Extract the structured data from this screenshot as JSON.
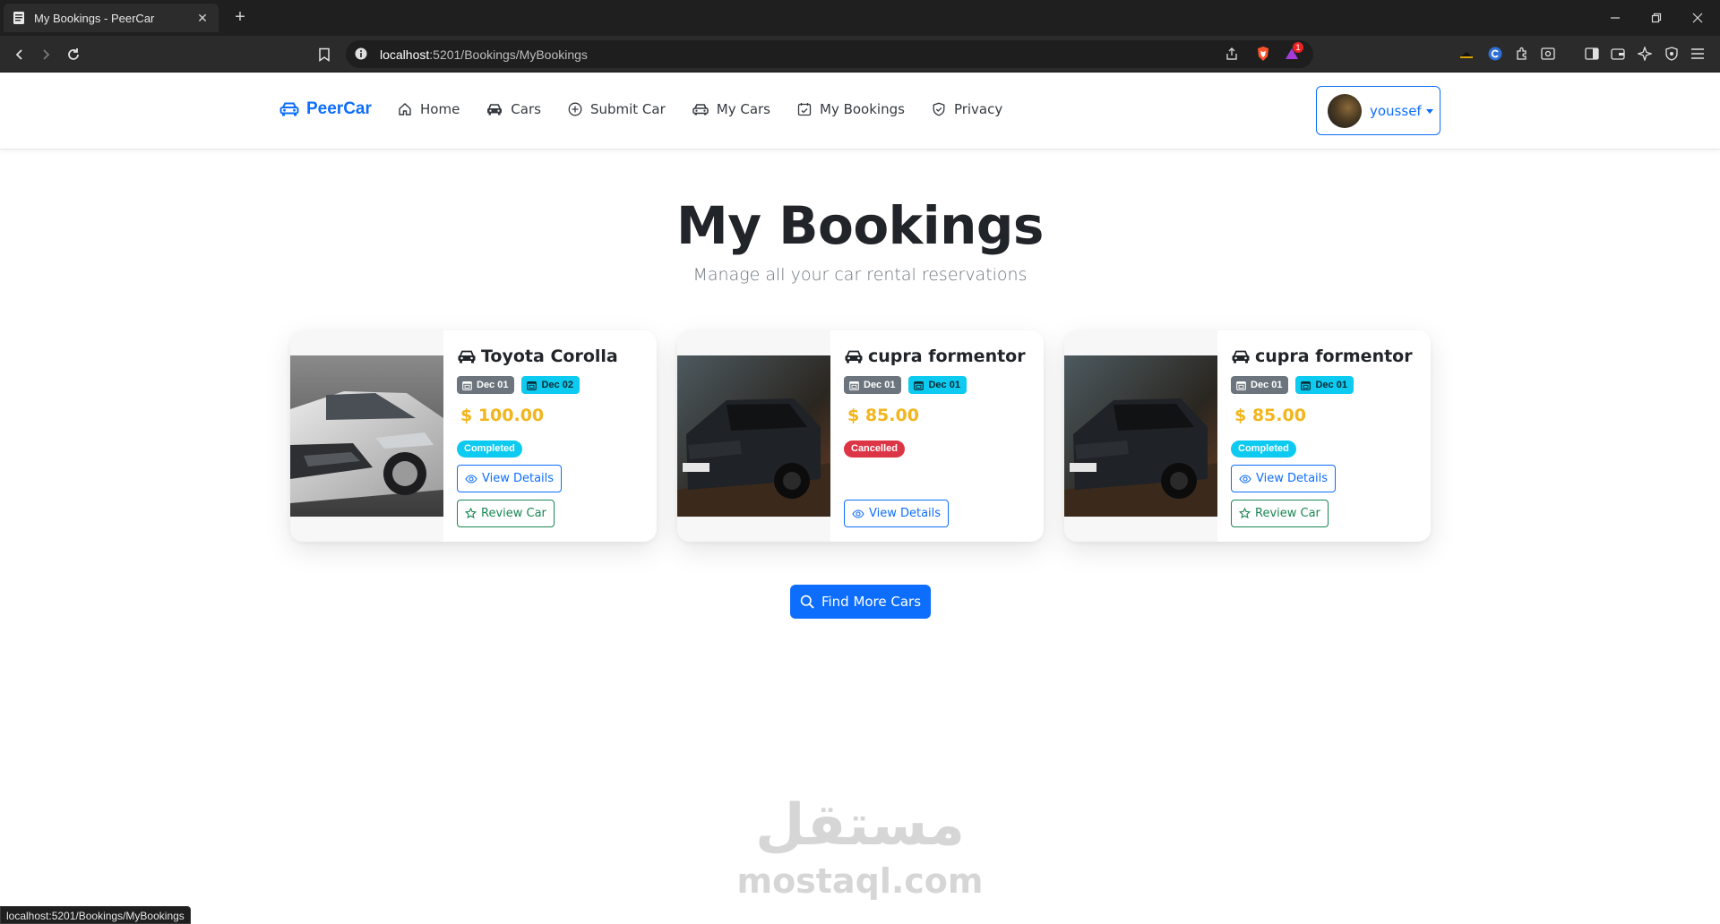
{
  "browser": {
    "tab_title": "My Bookings - PeerCar",
    "tab_close": "✕",
    "new_tab": "+",
    "url_host": "localhost",
    "url_path": ":5201/Bookings/MyBookings",
    "brave_badge_count": "1",
    "status_url": "localhost:5201/Bookings/MyBookings"
  },
  "navbar": {
    "brand": "PeerCar",
    "links": [
      {
        "label": "Home",
        "icon": "house-icon"
      },
      {
        "label": "Cars",
        "icon": "car-front-icon"
      },
      {
        "label": "Submit Car",
        "icon": "plus-circle-icon"
      },
      {
        "label": "My Cars",
        "icon": "car-icon"
      },
      {
        "label": "My Bookings",
        "icon": "calendar-check-icon"
      },
      {
        "label": "Privacy",
        "icon": "shield-check-icon"
      }
    ],
    "user_name": "youssef"
  },
  "header": {
    "title": "My Bookings",
    "subtitle": "Manage all your car rental reservations"
  },
  "bookings": [
    {
      "car": "Toyota Corolla",
      "start": "Dec 01",
      "end": "Dec 02",
      "price": "$ 100.00",
      "status": "Completed",
      "view_label": "View Details",
      "review_label": "Review Car",
      "photo": "silver-sedan"
    },
    {
      "car": "cupra formentor",
      "start": "Dec 01",
      "end": "Dec 01",
      "price": "$ 85.00",
      "status": "Cancelled",
      "view_label": "View Details",
      "review_label": "",
      "photo": "dark-suv"
    },
    {
      "car": "cupra formentor",
      "start": "Dec 01",
      "end": "Dec 01",
      "price": "$ 85.00",
      "status": "Completed",
      "view_label": "View Details",
      "review_label": "Review Car",
      "photo": "dark-suv"
    }
  ],
  "find_more_label": "Find More Cars",
  "watermark": {
    "arabic": "مستقل",
    "latin": "mostaql.com"
  },
  "colors": {
    "primary": "#0d6efd",
    "info": "#0dcaf0",
    "danger": "#dc3545",
    "success": "#198754",
    "warning": "#f2b51c",
    "secondary": "#6c757d"
  }
}
